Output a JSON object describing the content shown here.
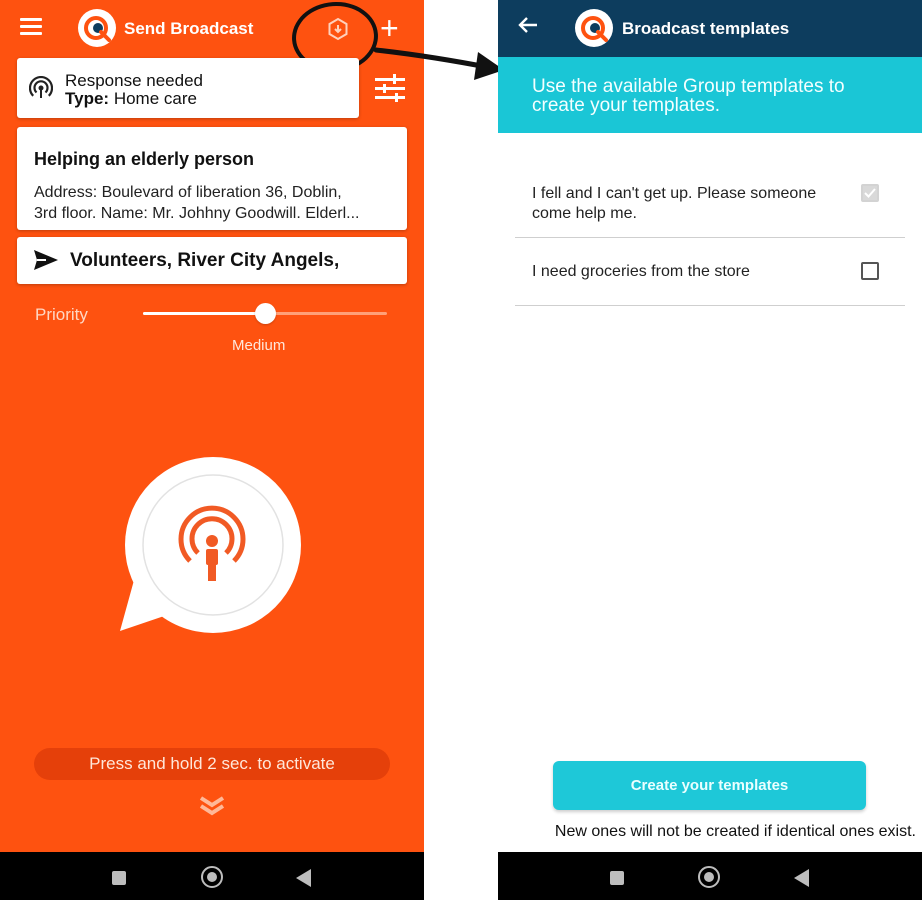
{
  "colors": {
    "brand_orange": "#fe5210",
    "header_navy": "#0d3d5e",
    "banner_teal": "#1ac6d6",
    "button_teal": "#1ec8d8"
  },
  "left_screen": {
    "header": {
      "title": "Send Broadcast",
      "menu_icon": "hamburger-icon",
      "templates_icon": "broadcast-templates-icon",
      "add_icon": "plus-icon"
    },
    "response_card": {
      "title": "Response needed",
      "type_label": "Type:",
      "type_value": "Home care",
      "icon": "broadcast-signal-icon"
    },
    "filter_icon": "sliders-icon",
    "message_card": {
      "title": "Helping an elderly person",
      "body_line1": "Address: Boulevard of liberation 36, Doblin,",
      "body_line2": "3rd floor. Name: Mr. Johhny Goodwill. Elderl..."
    },
    "recipients": {
      "icon": "send-icon",
      "text": "Volunteers, River City Angels,"
    },
    "priority": {
      "label": "Priority",
      "value_label": "Medium",
      "level": 0.5
    },
    "activate_button_icon": "person-broadcast-icon",
    "hint": "Press and hold 2 sec. to activate",
    "expand_icon": "double-chevron-down-icon"
  },
  "right_screen": {
    "header": {
      "title": "Broadcast templates",
      "back_icon": "back-arrow-icon"
    },
    "banner_text": "Use the available Group templates to create your templates.",
    "templates": [
      {
        "text": "I fell and I can't get up. Please someone come help me.",
        "checked": true
      },
      {
        "text": "I need groceries from the store",
        "checked": false
      }
    ],
    "create_button": "Create your templates",
    "note": "New ones will not be created if identical ones exist."
  },
  "system_nav": {
    "recents_icon": "square-recents-icon",
    "home_icon": "circle-home-icon",
    "back_icon": "triangle-back-icon"
  }
}
